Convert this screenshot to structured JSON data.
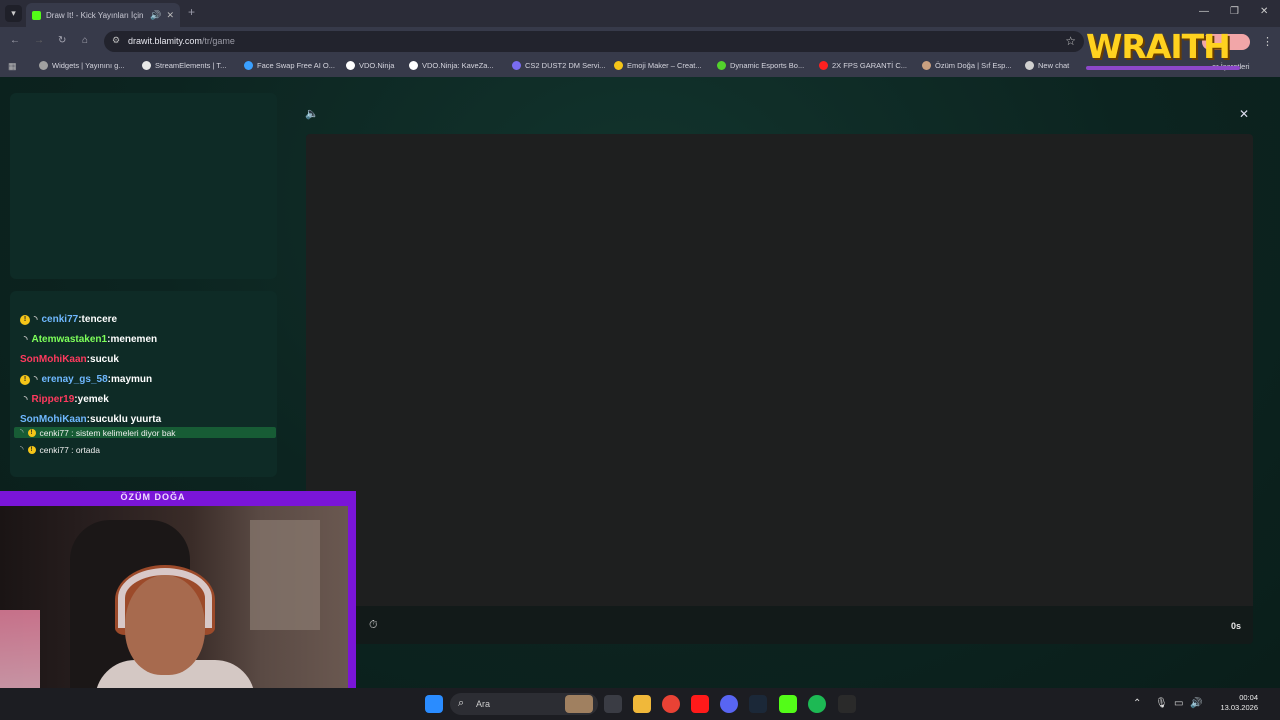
{
  "browser": {
    "tab": {
      "title": "Draw It! - Kick Yayınları İçin",
      "speaker_icon": "speaker-icon",
      "close_icon": "close-icon"
    },
    "new_tab": "+",
    "window_controls": {
      "minimize": "—",
      "maximize": "❐",
      "close": "✕"
    },
    "url": {
      "host": "drawit.blamity.com",
      "path": "/tr/game"
    },
    "bookmarks": [
      {
        "label": "Widgets | Yayınını g...",
        "color": "#a0a0a0"
      },
      {
        "label": "StreamElements | T...",
        "color": "#e8e8e8"
      },
      {
        "label": "Face Swap Free AI O...",
        "color": "#3aa0ff"
      },
      {
        "label": "VDO.Ninja",
        "color": "#ffffff"
      },
      {
        "label": "VDO.Ninja: KaveZa...",
        "color": "#ffffff"
      },
      {
        "label": "CS2 DUST2 DM Servi...",
        "color": "#7a6cf0"
      },
      {
        "label": "Emoji Maker – Creat...",
        "color": "#f5c518"
      },
      {
        "label": "Dynamic Esports Bo...",
        "color": "#53d22c"
      },
      {
        "label": "2X FPS GARANTİ C...",
        "color": "#ff2020"
      },
      {
        "label": "Özüm Doğa | Sıf Esp...",
        "color": "#c9a080"
      },
      {
        "label": "New chat",
        "color": "#d0d0d0"
      }
    ],
    "bookmarks_more": "er İşaretleri"
  },
  "overlay": {
    "wraith_text": "WRAITH"
  },
  "chat": [
    {
      "user": "cenki77",
      "msg": "tencere",
      "color": "#6fb8ff",
      "badge": true
    },
    {
      "user": "Atemwastaken1",
      "msg": "menemen",
      "color": "#7dff5a",
      "badge": false
    },
    {
      "user": "SonMohiKaan",
      "msg": "sucuk",
      "color": "#ff3a5e",
      "badge": false,
      "no_spinner": true
    },
    {
      "user": "erenay_gs_58",
      "msg": "maymun",
      "color": "#6fb8ff",
      "badge": true
    },
    {
      "user": "Ripper19",
      "msg": "yemek",
      "color": "#ff3a5e",
      "badge": false
    },
    {
      "user": "SonMohiKaan",
      "msg": "sucuklu yuurta",
      "color": "#6fb8ff",
      "badge": false,
      "no_spinner": true
    }
  ],
  "game_chat": [
    {
      "text": "cenki77 : sistem kelimeleri diyor bak",
      "highlight": true
    },
    {
      "text": "cenki77 : ortada",
      "highlight": false
    }
  ],
  "game": {
    "timer": "0s"
  },
  "webcam": {
    "label": "ÖZÜM DOĞA"
  },
  "taskbar": {
    "search_label": "Ara",
    "clock_time": "00:04",
    "clock_date": "13.03.2026"
  }
}
